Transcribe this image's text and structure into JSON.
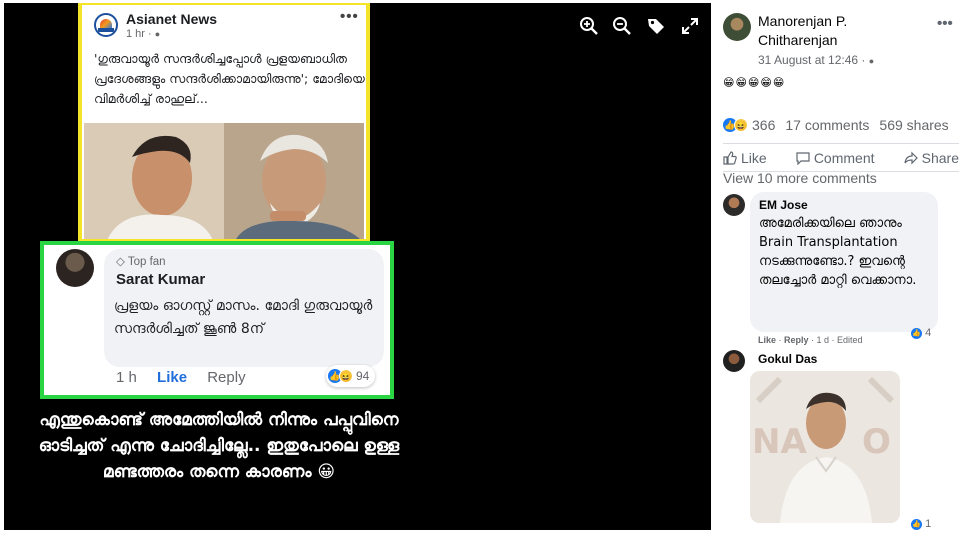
{
  "viewer": {
    "toolbar": [
      "zoom-in-icon",
      "zoom-out-icon",
      "tag-icon",
      "fullscreen-icon"
    ],
    "embedded_post": {
      "source": "Asianet News",
      "time": "1 hr · ",
      "text": "'ഗുരുവായൂർ സന്ദർശിച്ചപ്പോൾ പ്രളയബാധിത പ്രദേശങ്ങളും സന്ദർശിക്കാമായിരുന്നു'; മോദിയെ വിമർശിച്ച് രാഹുല്...",
      "dots": "•••"
    },
    "fan_comment": {
      "badge": "Top fan",
      "name": "Sarat Kumar",
      "text": "പ്രളയം ഓഗസ്റ്റ് മാസം. മോദി ഗുരുവായൂർ സന്ദർശിച്ചത് ജൂൺ 8ന്",
      "time": "1 h",
      "like": "Like",
      "reply": "Reply",
      "reactions": "94"
    },
    "caption": "എന്തുകൊണ്ട് അമേത്തിയിൽ നിന്നും പപ്പുവിനെ ഓടിച്ചത് എന്നു ചോദിച്ചില്ലേ.. ഇതുപോലെ ഉള്ള മണ്ടത്തരം തന്നെ കാരണം 😀"
  },
  "panel": {
    "author": "Manorenjan P. Chitharenjan",
    "date": "31 August at 12:46 · ",
    "emojis": "😁😁😁😁😁",
    "reactions_count": "366",
    "comments_count": "17 comments",
    "shares_count": "569 shares",
    "actions": {
      "like": "Like",
      "comment": "Comment",
      "share": "Share"
    },
    "view_more": "View 10 more comments",
    "comments": [
      {
        "name": "EM Jose",
        "text": "അമേരിക്കയിലെ ഞാനും Brain Transplantation നടക്കുന്നുണ്ടോ.? ഇവന്റെ തലച്ചോർ മാറ്റി വെക്കാനാ.",
        "like": "Like",
        "reply": "Reply",
        "time": "1 d",
        "edited": "Edited",
        "reactions": "4"
      },
      {
        "name": "Gokul Das",
        "reactions": "1"
      }
    ]
  },
  "colors": {
    "viewer_bg": "#000000",
    "yellow_frame": "#f4e427",
    "green_frame": "#2ad443",
    "link_blue": "#216fdb",
    "like_blue": "#1877f2"
  }
}
